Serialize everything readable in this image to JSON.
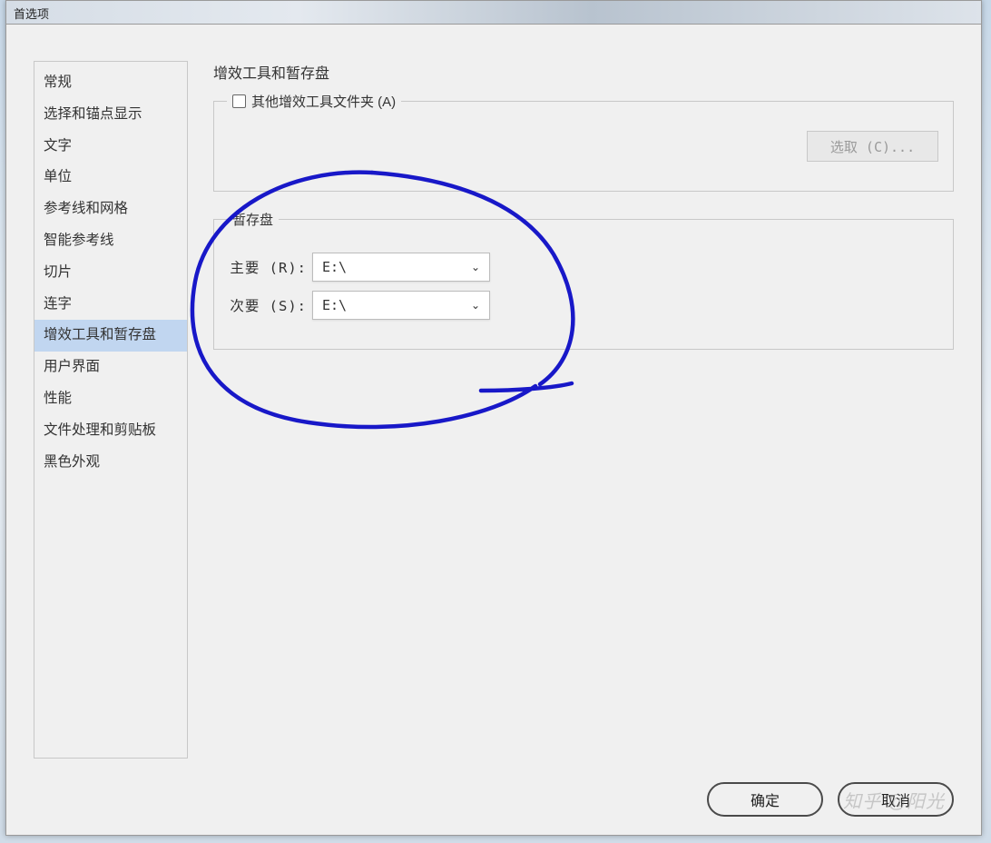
{
  "window": {
    "title": "首选项"
  },
  "sidebar": {
    "items": [
      {
        "label": "常规"
      },
      {
        "label": "选择和锚点显示"
      },
      {
        "label": "文字"
      },
      {
        "label": "单位"
      },
      {
        "label": "参考线和网格"
      },
      {
        "label": "智能参考线"
      },
      {
        "label": "切片"
      },
      {
        "label": "连字"
      },
      {
        "label": "增效工具和暂存盘"
      },
      {
        "label": "用户界面"
      },
      {
        "label": "性能"
      },
      {
        "label": "文件处理和剪贴板"
      },
      {
        "label": "黑色外观"
      }
    ],
    "selected_index": 8
  },
  "main": {
    "title": "增效工具和暂存盘",
    "plugins_group": {
      "checkbox_label": "其他增效工具文件夹 (A)",
      "choose_button": "选取 (C)..."
    },
    "scratch_group": {
      "legend": "暂存盘",
      "primary_label": "主要 (R):",
      "primary_value": "E:\\",
      "secondary_label": "次要 (S):",
      "secondary_value": "E:\\"
    }
  },
  "footer": {
    "ok": "确定",
    "cancel": "取消"
  },
  "watermark": "知乎 @阳光"
}
